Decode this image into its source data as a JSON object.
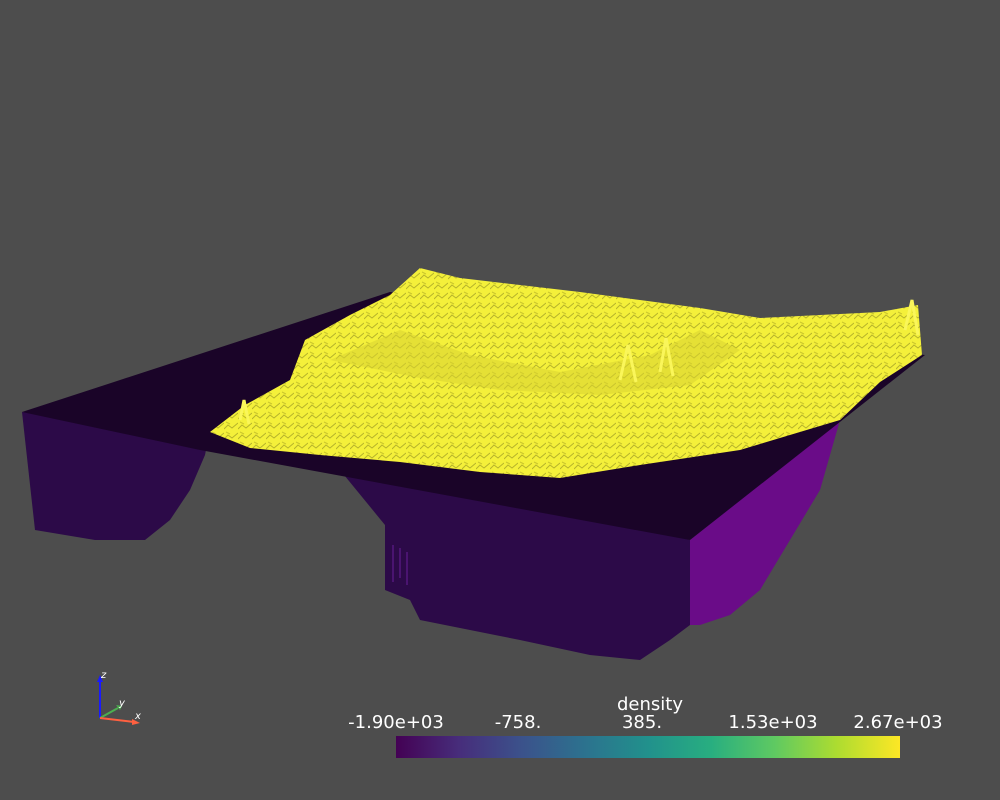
{
  "scene": {
    "background": "#4d4d4d",
    "surface_color": "#fafa3c",
    "slab_top_color": "#1a0428",
    "slab_side_color": "#2c0a48",
    "slab_right_color": "#6a0c88"
  },
  "colorbar": {
    "title": "density",
    "colormap": "viridis",
    "range": [
      -1900,
      2670
    ],
    "ticks": [
      "-1.90e+03",
      "-758.",
      "385.",
      "1.53e+03",
      "2.67e+03"
    ]
  },
  "axes_widget": {
    "z_label": "z",
    "y_label": "y",
    "x_label": "x",
    "z_color": "#1a1aff",
    "y_color": "#4caf50",
    "x_color": "#ff6040"
  }
}
